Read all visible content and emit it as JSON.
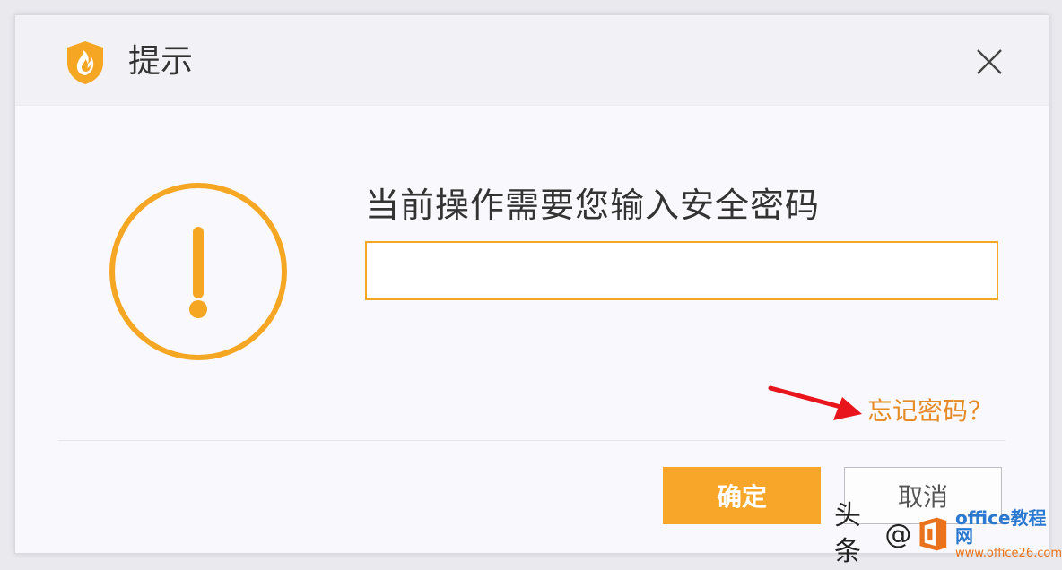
{
  "dialog": {
    "title": "提示",
    "logo_icon": "flame-shield-icon",
    "close_icon": "close-icon",
    "warning_icon": "exclamation-circle-icon",
    "prompt": "当前操作需要您输入安全密码",
    "password": {
      "value": "",
      "placeholder": ""
    },
    "forgot_link": "忘记密码？",
    "ok_label": "确定",
    "cancel_label": "取消"
  },
  "watermark": {
    "text": "头条",
    "at": "@",
    "site_name": "office教程网",
    "site_url": "www.office26.com"
  },
  "colors": {
    "accent": "#f5a623",
    "link": "#e58a24",
    "annotation_arrow": "#e8161c",
    "ok_button": "#f8a62a"
  }
}
